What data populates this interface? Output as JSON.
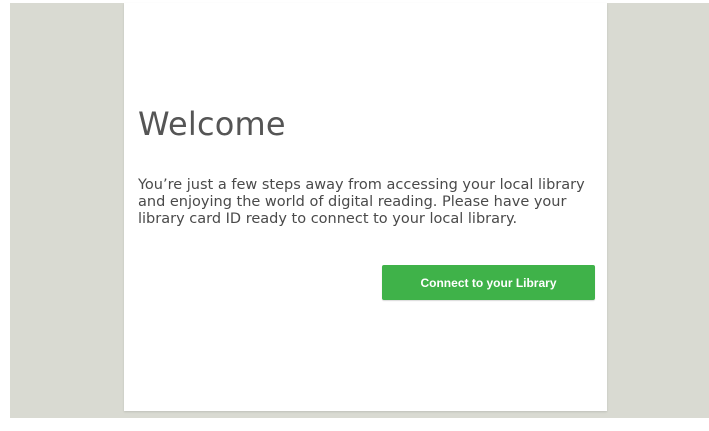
{
  "welcome": {
    "title": "Welcome",
    "message": "You’re just a few steps away from accessing your local library and enjoying the world of digital reading. Please have your library card ID ready to connect to your local library.",
    "connect_button_label": "Connect to your Library"
  },
  "colors": {
    "background": "#d9dad2",
    "card": "#ffffff",
    "button": "#3fb249",
    "button_text": "#ffffff",
    "title_text": "#555555",
    "body_text": "#4a4a4a"
  }
}
